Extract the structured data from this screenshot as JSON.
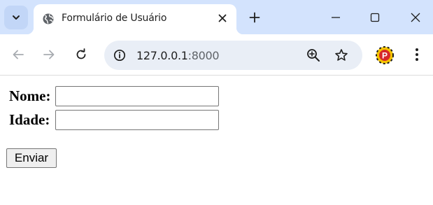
{
  "browser": {
    "tab": {
      "title": "Formulário de Usuário",
      "favicon_icon": "globe-icon"
    },
    "new_tab_icon": "plus-icon",
    "window_controls": [
      "minimize-icon",
      "maximize-icon",
      "close-icon"
    ],
    "address_bar": {
      "host": "127.0.0.1",
      "port": ":8000"
    },
    "profile_badge": "P",
    "accent_color": "#d3e3fd"
  },
  "form": {
    "name_label": "Nome:",
    "name_value": "",
    "age_label": "Idade:",
    "age_value": "",
    "submit_label": "Enviar"
  }
}
